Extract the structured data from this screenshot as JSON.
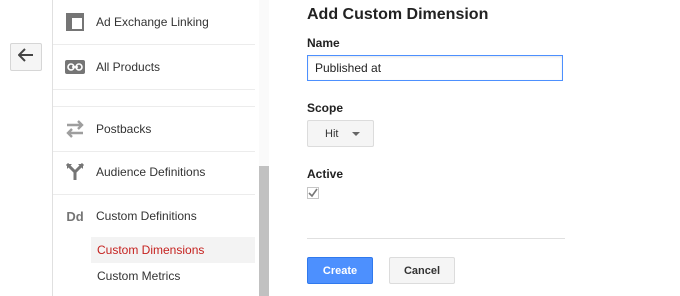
{
  "nav": {
    "items": [
      {
        "label": "Ad Exchange Linking",
        "icon": "ad-exchange-icon"
      },
      {
        "label": "All Products",
        "icon": "link-icon"
      },
      {
        "label": "Postbacks",
        "icon": "postbacks-icon"
      },
      {
        "label": "Audience Definitions",
        "icon": "audience-icon"
      },
      {
        "label": "Custom Definitions",
        "icon": "dd-icon",
        "icon_text": "Dd"
      }
    ],
    "sub_items": [
      {
        "label": "Custom Dimensions",
        "active": true
      },
      {
        "label": "Custom Metrics",
        "active": false
      }
    ]
  },
  "form": {
    "title": "Add Custom Dimension",
    "name_label": "Name",
    "name_value": "Published at",
    "scope_label": "Scope",
    "scope_value": "Hit",
    "active_label": "Active",
    "active_checked": true,
    "create_label": "Create",
    "cancel_label": "Cancel"
  },
  "colors": {
    "accent": "#4d90fe",
    "active_nav": "#c5221f"
  }
}
